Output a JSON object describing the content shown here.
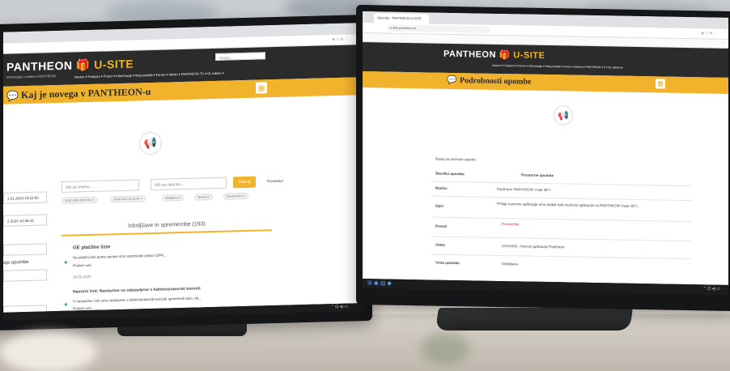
{
  "left": {
    "brand": "PANTHEON",
    "brand_suffix": "U-SITE",
    "tagline": "Informacije o sistemu PANTHEON",
    "search_placeholder": "Iskanje...",
    "menu": "Novice ▾   Podpora ▾   Poroci ▾   Informacije ▾   Moji podatki ▾   Forum ▾   Admin ▾   PANTHEON TV ▾   DL Admin ▾",
    "header_title": "Kaj je novega v PANTHEON-u",
    "filter_user": "Išči po imenu...",
    "filter_type": "Išči po opombi...",
    "filter_button": "Filtriraj",
    "reset_link": "Ponastavi",
    "date_1": "1.01.2024 10:53:00",
    "date_2": "2.2024 10:36:20",
    "side_label": "aja opombe",
    "section_title": "Izboljšave in spremembe (193)",
    "item1_title": "GE plačilne liste",
    "item1_text": "Na plačilni listi pomo sprave smo spremenili pribor (OPA...",
    "read_more": "Preberi več",
    "item1_meta": "16.02.2024",
    "item2_title": "Namizni Vsti: Nastavitve so odstavljene v Administratorski konzoli",
    "item2_text": "V nastavitev Vsti smo nastavitve v Administratorski konzoli spremenili tako, da...",
    "read_more_2": "Preberi več"
  },
  "right": {
    "tab_label": "Opombe - PANTHEON U-SITE",
    "url": "u-site.pantheon.si",
    "brand": "PANTHEON",
    "brand_suffix": "U-SITE",
    "menu": "Novice ▾   Podpora ▾   Poroci ▾   Informacije ▾   Moji podatki ▾   Forum ▾   Admin ▾   PANTHEON TV ▾   DL Admin ▾",
    "header_title": "Podrobnosti opombe",
    "back_link": "Nazaj na seznam opomb",
    "rows": [
      {
        "label": "Številka opombe",
        "value": "Prostorne opombe"
      },
      {
        "label": "Naslov",
        "value": "Pantheon PANTHEON Vsak NFT"
      },
      {
        "label": "Opis",
        "value": "Prilagi namizne aplikacije smo dodali tudi možnost aplikacije za PANTHEON Vsak NFT..."
      },
      {
        "label": "Povezi",
        "value": "Prostorfike"
      },
      {
        "label": "Video",
        "value": "UG14433 - Novost aplikacije Pantheon"
      },
      {
        "label": "Vrsta opombe",
        "value": "Izboljšava"
      }
    ]
  },
  "colors": {
    "accent": "#f2b32c",
    "dark": "#2b2b2b"
  }
}
